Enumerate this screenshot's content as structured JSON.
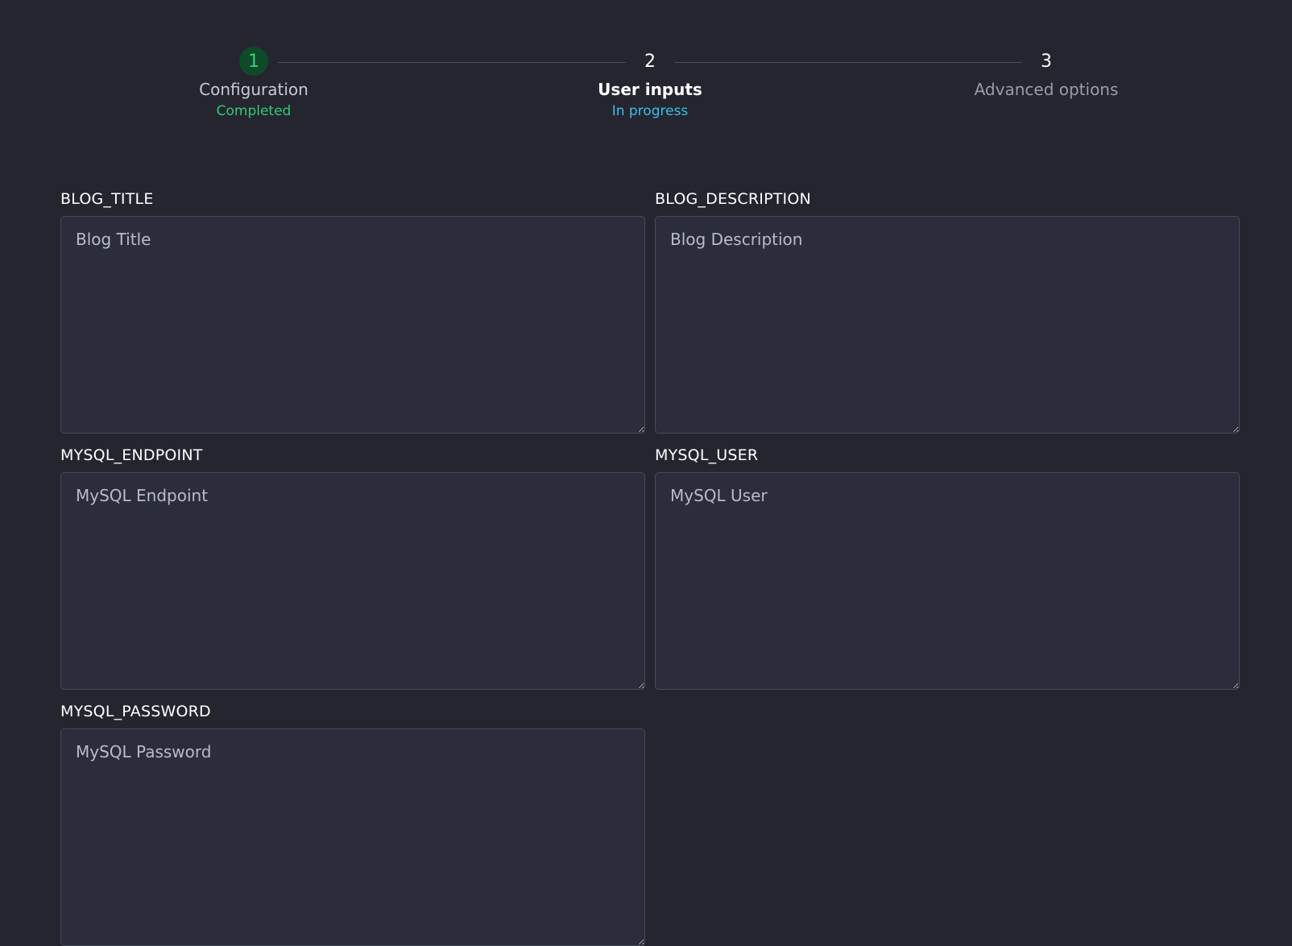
{
  "stepper": {
    "steps": [
      {
        "number": "1",
        "title": "Configuration",
        "status": "Completed",
        "state": "completed"
      },
      {
        "number": "2",
        "title": "User inputs",
        "status": "In progress",
        "state": "active"
      },
      {
        "number": "3",
        "title": "Advanced options",
        "status": "",
        "state": "pending"
      }
    ]
  },
  "form": {
    "fields": [
      {
        "label": "BLOG_TITLE",
        "placeholder": "Blog Title"
      },
      {
        "label": "BLOG_DESCRIPTION",
        "placeholder": "Blog Description"
      },
      {
        "label": "MYSQL_ENDPOINT",
        "placeholder": "MySQL Endpoint"
      },
      {
        "label": "MYSQL_USER",
        "placeholder": "MySQL User"
      },
      {
        "label": "MYSQL_PASSWORD",
        "placeholder": "MySQL Password"
      }
    ]
  },
  "colors": {
    "background": "#24252f",
    "input_background": "#2b2d3c",
    "completed": "#34c97a",
    "in_progress": "#3bbfe8"
  }
}
